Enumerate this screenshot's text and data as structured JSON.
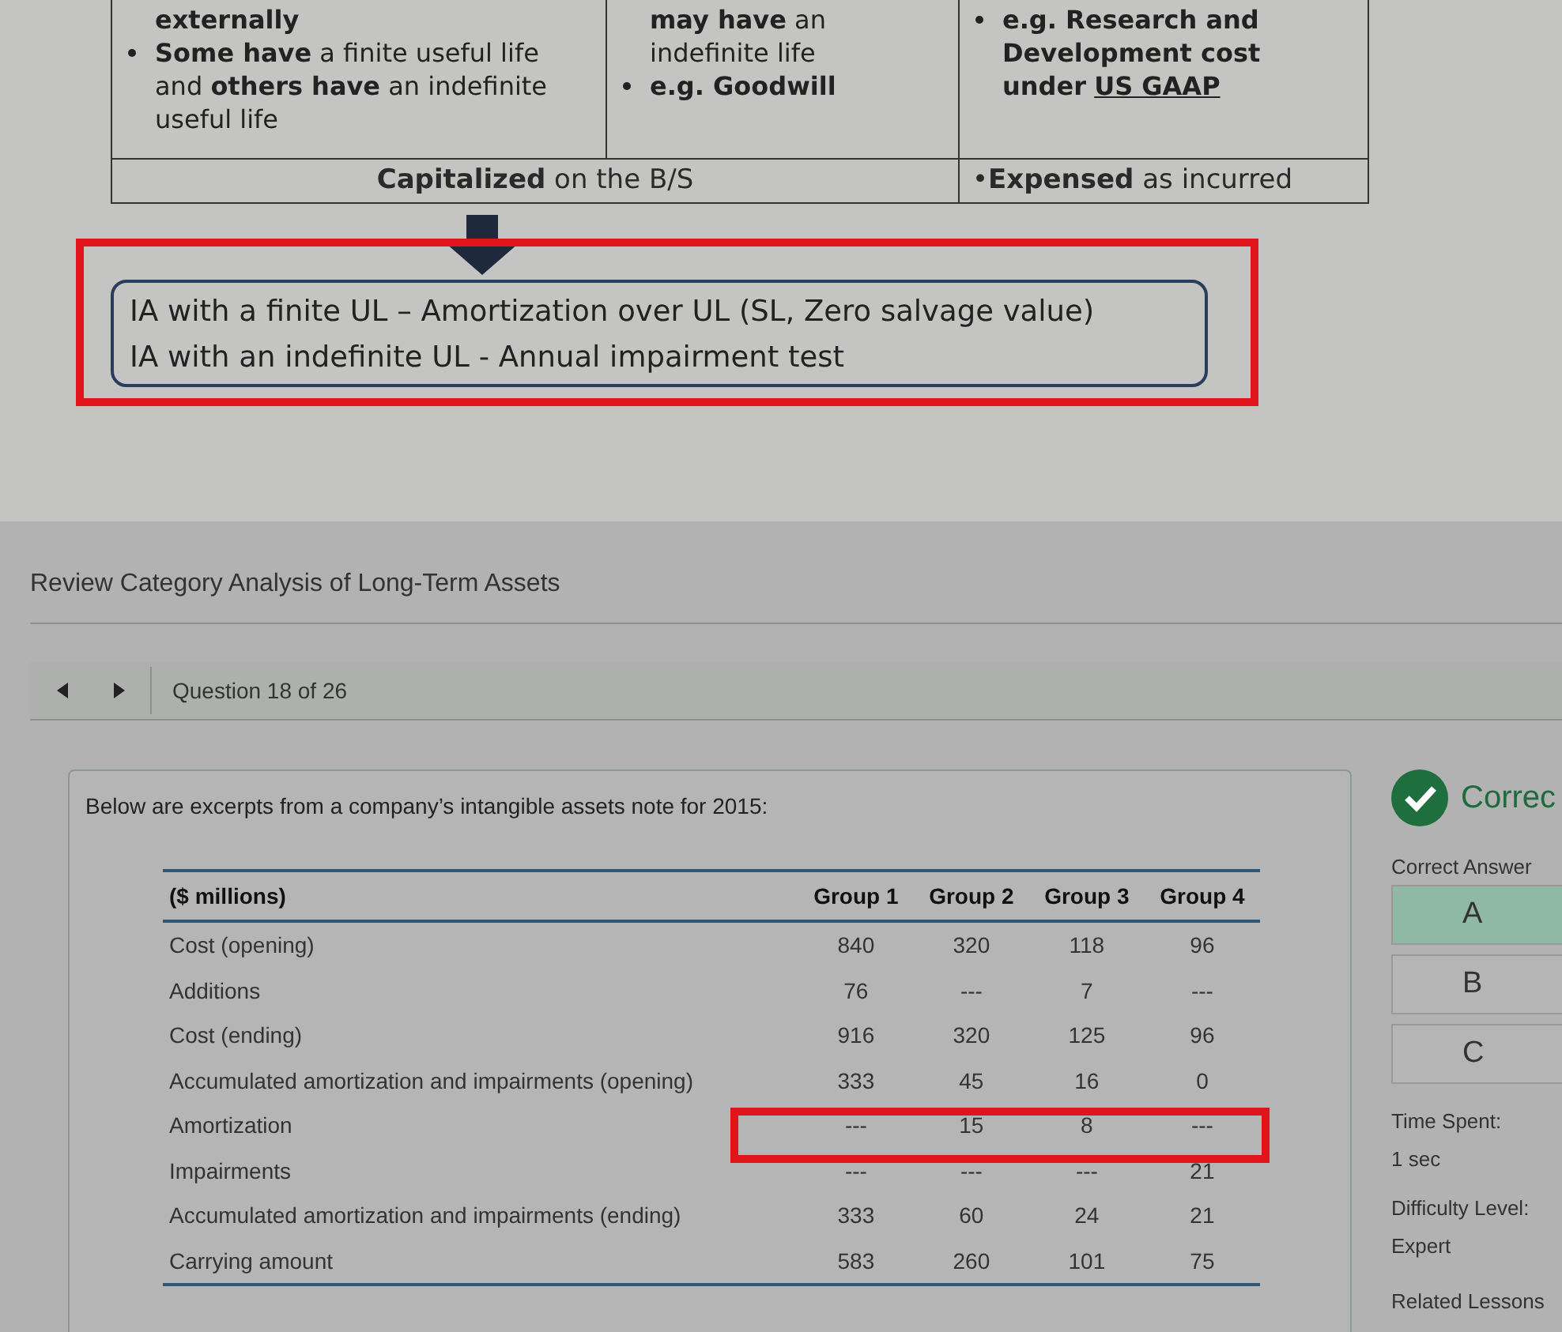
{
  "slide": {
    "columns": [
      {
        "items": [
          {
            "text": "**externally**",
            "bullet": false
          },
          {
            "text": "**Some have** a finite useful life and **others have** an indefinite useful life",
            "bullet": true
          }
        ]
      },
      {
        "items": [
          {
            "text": "**may have** an indefinite life",
            "bullet": false
          },
          {
            "text": "**e.g. Goodwill**",
            "bullet": true
          }
        ]
      },
      {
        "items": [
          {
            "text": "**e.g. Research and**",
            "bullet": true
          },
          {
            "text": "**Development cost under**",
            "bullet": false,
            "underlined": "US GAAP"
          }
        ]
      }
    ],
    "footer": [
      "**Capitalized** on the B/S",
      "•**Expensed** as incurred"
    ],
    "summary": [
      "IA with a finite UL – Amortization over UL (SL, Zero salvage value)",
      "IA with an indefinite UL -  Annual impairment test"
    ]
  },
  "page_title": "Review Category Analysis of Long-Term Assets",
  "question_counter": "Question 18 of 26",
  "question_intro": "Below are excerpts from a company’s intangible assets note for 2015:",
  "table": {
    "columns": [
      "($ millions)",
      "Group 1",
      "Group 2",
      "Group 3",
      "Group 4"
    ],
    "rows": [
      {
        "label": "Cost (opening)",
        "values": [
          "840",
          "320",
          "118",
          "96"
        ],
        "highlighted": false
      },
      {
        "label": "Additions",
        "values": [
          "76",
          "---",
          "7",
          "---"
        ],
        "highlighted": false
      },
      {
        "label": "Cost (ending)",
        "values": [
          "916",
          "320",
          "125",
          "96"
        ],
        "highlighted": false
      },
      {
        "label": "Accumulated amortization and impairments (opening)",
        "values": [
          "333",
          "45",
          "16",
          "0"
        ],
        "highlighted": false
      },
      {
        "label": "Amortization",
        "values": [
          "---",
          "15",
          "8",
          "---"
        ],
        "highlighted": true
      },
      {
        "label": "Impairments",
        "values": [
          "---",
          "---",
          "---",
          "21"
        ],
        "highlighted": false
      },
      {
        "label": "Accumulated amortization and impairments (ending)",
        "values": [
          "333",
          "60",
          "24",
          "21"
        ],
        "highlighted": false
      },
      {
        "label": "Carrying amount",
        "values": [
          "583",
          "260",
          "101",
          "75"
        ],
        "highlighted": false
      }
    ]
  },
  "result": {
    "status": "Correc",
    "correct_answer_label": "Correct Answer",
    "options": [
      {
        "label": "A",
        "selected": true
      },
      {
        "label": "B",
        "selected": false
      },
      {
        "label": "C",
        "selected": false
      }
    ],
    "stats": [
      {
        "label": "Time Spent:",
        "value": "1 sec"
      },
      {
        "label": "Difficulty Level:",
        "value": "Expert"
      }
    ],
    "related": "Related Lessons"
  }
}
